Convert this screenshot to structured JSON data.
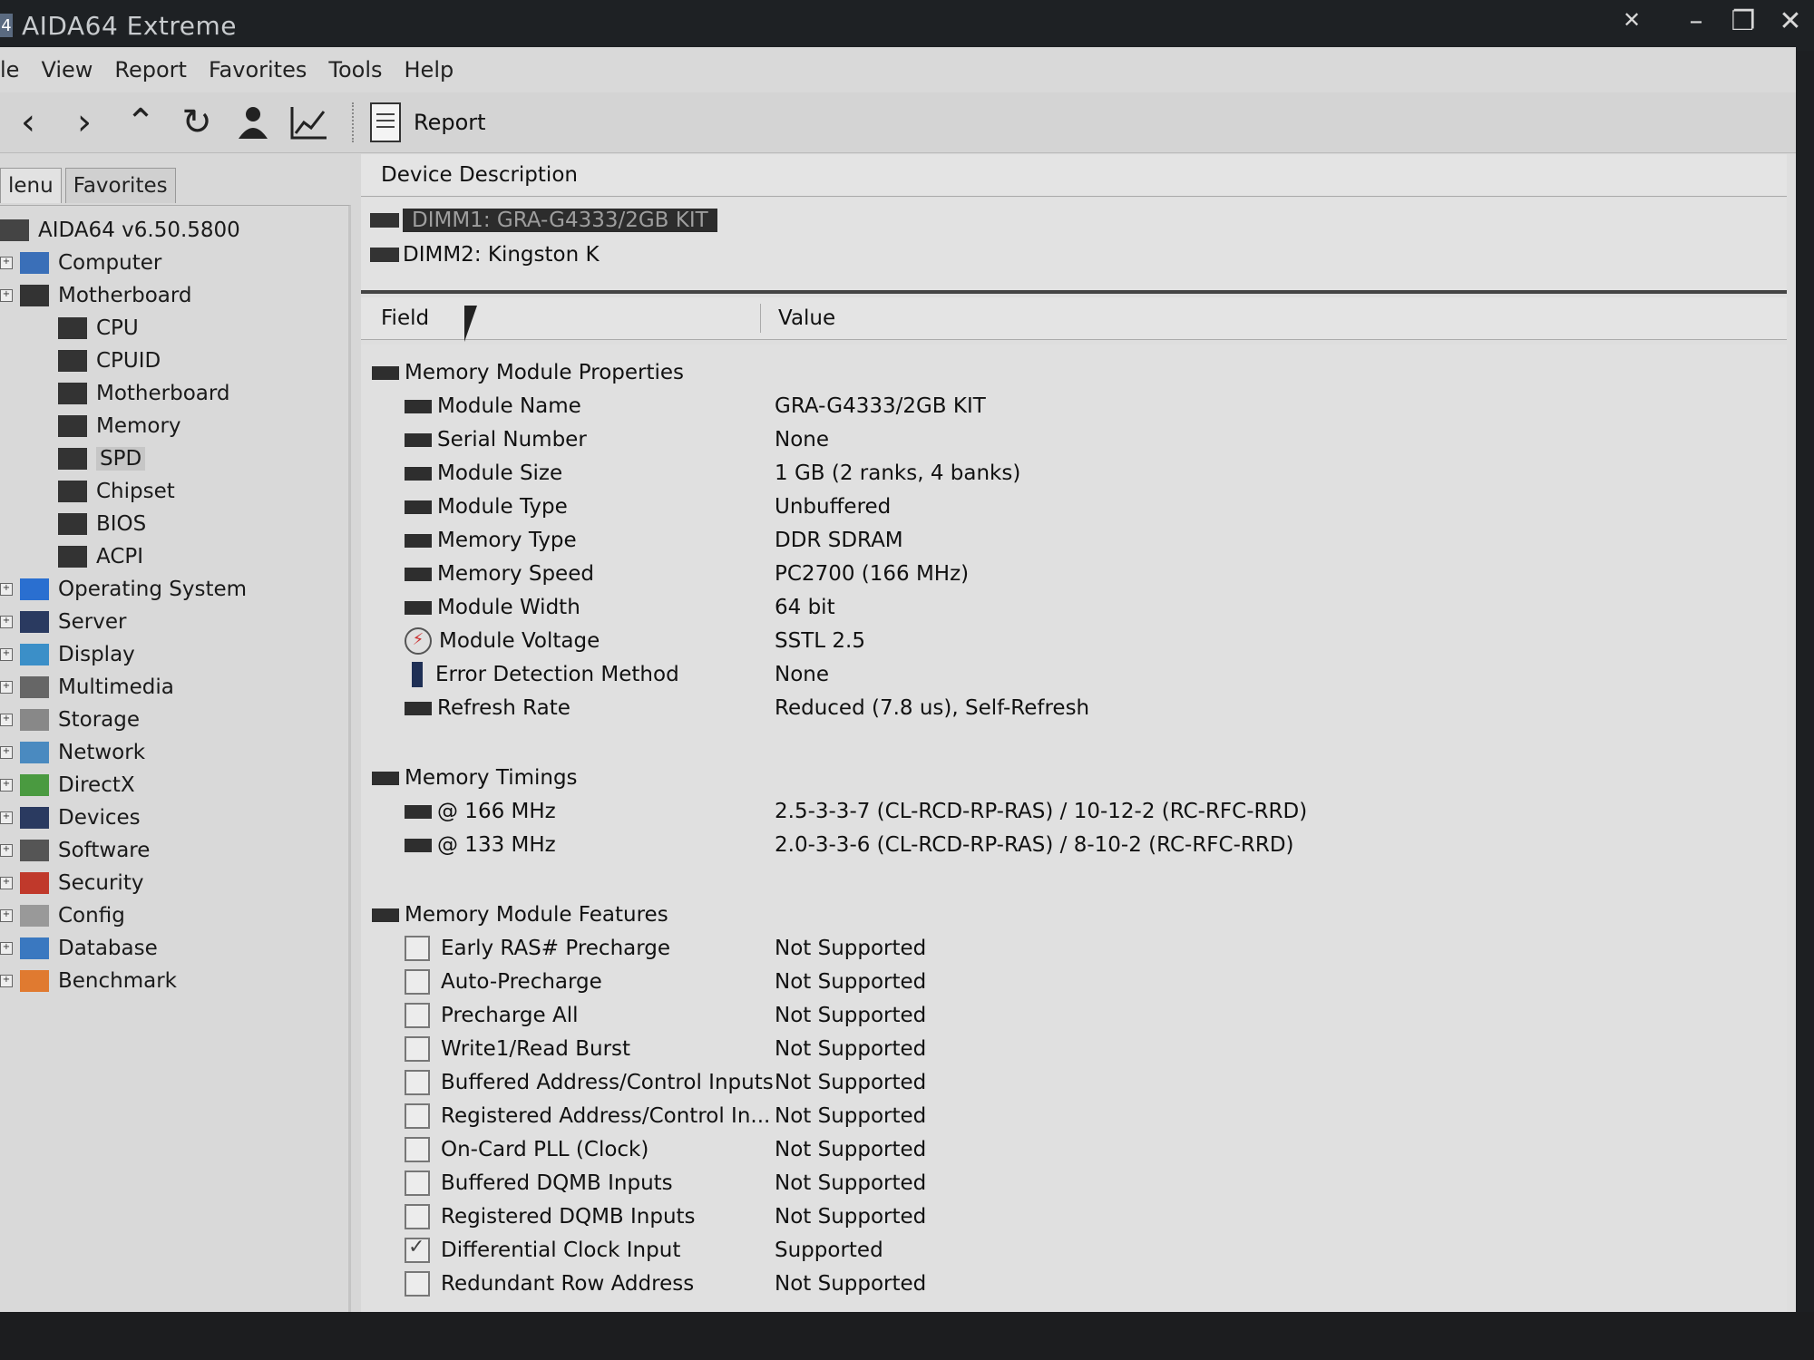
{
  "window": {
    "title": "AIDA64 Extreme",
    "app_icon_glyph": "4",
    "controls": [
      "✕",
      "–",
      "❐",
      "✕"
    ]
  },
  "menu": [
    "le",
    "View",
    "Report",
    "Favorites",
    "Tools",
    "Help"
  ],
  "toolbar": {
    "icons": [
      "back-icon",
      "forward-icon",
      "up-icon",
      "refresh-icon",
      "user-icon",
      "chart-icon"
    ],
    "report_label": "Report"
  },
  "tabs": [
    "lenu",
    "Favorites"
  ],
  "tree": [
    {
      "label": "AIDA64 v6.50.5800",
      "level": 0,
      "icon": "aida-icon",
      "color": "#444"
    },
    {
      "label": "Computer",
      "level": 1,
      "icon": "computer-icon",
      "color": "#3a6fb8"
    },
    {
      "label": "Motherboard",
      "level": 1,
      "icon": "motherboard-icon",
      "color": "#333"
    },
    {
      "label": "CPU",
      "level": 2,
      "icon": "cpu-icon",
      "color": "#333"
    },
    {
      "label": "CPUID",
      "level": 2,
      "icon": "cpuid-icon",
      "color": "#333"
    },
    {
      "label": "Motherboard",
      "level": 2,
      "icon": "motherboard-icon",
      "color": "#333"
    },
    {
      "label": "Memory",
      "level": 2,
      "icon": "memory-icon",
      "color": "#333"
    },
    {
      "label": "SPD",
      "level": 2,
      "icon": "spd-icon",
      "color": "#333",
      "selected": true
    },
    {
      "label": "Chipset",
      "level": 2,
      "icon": "chipset-icon",
      "color": "#333"
    },
    {
      "label": "BIOS",
      "level": 2,
      "icon": "bios-icon",
      "color": "#333"
    },
    {
      "label": "ACPI",
      "level": 2,
      "icon": "acpi-icon",
      "color": "#333"
    },
    {
      "label": "Operating System",
      "level": 1,
      "icon": "windows-icon",
      "color": "#2a6fd0"
    },
    {
      "label": "Server",
      "level": 1,
      "icon": "server-icon",
      "color": "#2a3a60"
    },
    {
      "label": "Display",
      "level": 1,
      "icon": "display-icon",
      "color": "#3b8fc8"
    },
    {
      "label": "Multimedia",
      "level": 1,
      "icon": "speaker-icon",
      "color": "#666"
    },
    {
      "label": "Storage",
      "level": 1,
      "icon": "storage-icon",
      "color": "#888"
    },
    {
      "label": "Network",
      "level": 1,
      "icon": "network-icon",
      "color": "#4a8ac0"
    },
    {
      "label": "DirectX",
      "level": 1,
      "icon": "xbox-icon",
      "color": "#4a9a40"
    },
    {
      "label": "Devices",
      "level": 1,
      "icon": "devices-icon",
      "color": "#2a3a60"
    },
    {
      "label": "Software",
      "level": 1,
      "icon": "software-icon",
      "color": "#555"
    },
    {
      "label": "Security",
      "level": 1,
      "icon": "shield-icon",
      "color": "#c0392b"
    },
    {
      "label": "Config",
      "level": 1,
      "icon": "config-icon",
      "color": "#999"
    },
    {
      "label": "Database",
      "level": 1,
      "icon": "database-icon",
      "color": "#3a78c0"
    },
    {
      "label": "Benchmark",
      "level": 1,
      "icon": "benchmark-icon",
      "color": "#e07a30"
    }
  ],
  "device_header": "Device Description",
  "devices": [
    {
      "label": "DIMM1: GRA-G4333/2GB KIT",
      "selected": true
    },
    {
      "label": "DIMM2: Kingston K",
      "selected": false
    }
  ],
  "columns": {
    "field": "Field",
    "value": "Value"
  },
  "rows": [
    {
      "type": "group",
      "field": "Memory Module Properties",
      "value": ""
    },
    {
      "type": "item",
      "icon": "chip",
      "field": "Module Name",
      "value": "GRA-G4333/2GB KIT"
    },
    {
      "type": "item",
      "icon": "chip",
      "field": "Serial Number",
      "value": "None"
    },
    {
      "type": "item",
      "icon": "chip",
      "field": "Module Size",
      "value": "1 GB (2 ranks, 4 banks)"
    },
    {
      "type": "item",
      "icon": "chip",
      "field": "Module Type",
      "value": "Unbuffered"
    },
    {
      "type": "item",
      "icon": "chip",
      "field": "Memory Type",
      "value": "DDR SDRAM"
    },
    {
      "type": "item",
      "icon": "chip",
      "field": "Memory Speed",
      "value": "PC2700 (166 MHz)"
    },
    {
      "type": "item",
      "icon": "chip",
      "field": "Module Width",
      "value": "64 bit"
    },
    {
      "type": "item",
      "icon": "bolt",
      "field": "Module Voltage",
      "value": "SSTL 2.5"
    },
    {
      "type": "item",
      "icon": "bar",
      "field": "Error Detection Method",
      "value": "None"
    },
    {
      "type": "item",
      "icon": "chip",
      "field": "Refresh Rate",
      "value": "Reduced (7.8 us), Self-Refresh"
    },
    {
      "type": "spacer"
    },
    {
      "type": "group",
      "field": "Memory Timings",
      "value": ""
    },
    {
      "type": "item",
      "icon": "chip",
      "field": "@ 166 MHz",
      "value": "2.5-3-3-7  (CL-RCD-RP-RAS) / 10-12-2  (RC-RFC-RRD)"
    },
    {
      "type": "item",
      "icon": "chip",
      "field": "@ 133 MHz",
      "value": "2.0-3-3-6  (CL-RCD-RP-RAS) / 8-10-2  (RC-RFC-RRD)"
    },
    {
      "type": "spacer"
    },
    {
      "type": "group",
      "field": "Memory Module Features",
      "value": ""
    },
    {
      "type": "check",
      "checked": false,
      "field": "Early RAS# Precharge",
      "value": "Not Supported"
    },
    {
      "type": "check",
      "checked": false,
      "field": "Auto-Precharge",
      "value": "Not Supported"
    },
    {
      "type": "check",
      "checked": false,
      "field": "Precharge All",
      "value": "Not Supported"
    },
    {
      "type": "check",
      "checked": false,
      "field": "Write1/Read Burst",
      "value": "Not Supported"
    },
    {
      "type": "check",
      "checked": false,
      "field": "Buffered Address/Control Inputs",
      "value": "Not Supported"
    },
    {
      "type": "check",
      "checked": false,
      "field": "Registered Address/Control In...",
      "value": "Not Supported"
    },
    {
      "type": "check",
      "checked": false,
      "field": "On-Card PLL (Clock)",
      "value": "Not Supported"
    },
    {
      "type": "check",
      "checked": false,
      "field": "Buffered DQMB Inputs",
      "value": "Not Supported"
    },
    {
      "type": "check",
      "checked": false,
      "field": "Registered DQMB Inputs",
      "value": "Not Supported"
    },
    {
      "type": "check",
      "checked": true,
      "field": "Differential Clock Input",
      "value": "Supported"
    },
    {
      "type": "check",
      "checked": false,
      "field": "Redundant Row Address",
      "value": "Not Supported"
    }
  ]
}
